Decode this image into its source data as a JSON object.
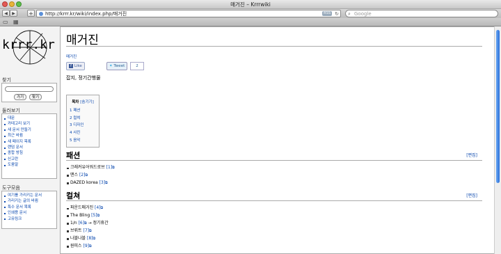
{
  "window": {
    "title": "매거진 – Krrrwiki"
  },
  "browser": {
    "back_label": "◀",
    "forward_label": "▶",
    "add_label": "+",
    "url": "http://krrr.kr/wiki/index.php/매거진",
    "rss_label": "RSS",
    "search_placeholder": "Google"
  },
  "sidebar": {
    "logo_text": "krrr.kr",
    "search_heading": "찾기",
    "go_button": "가기",
    "search_button": "찾기",
    "nav_heading": "둘러보기",
    "nav_items": [
      "대문",
      "카테고리 보기",
      "새 문서 만들기",
      "최근 바뀜",
      "새 페이지 목록",
      "랜덤 문서",
      "종합 방침",
      "신고란",
      "도움말"
    ],
    "tools_heading": "도구모음",
    "tool_items": [
      "여기를 가리키는 문서",
      "가리키는 글의 바뀜",
      "특수 문서 목록",
      "인쇄용 문서",
      "고유링크"
    ]
  },
  "content": {
    "title": "매거진",
    "category_tag": "매거진",
    "like_label": "Like",
    "tweet_label": "Tweet",
    "tweet_count": "2",
    "description": "잡지, 정기간행물",
    "toc": {
      "title": "목차",
      "toggle": "[숨기기]",
      "items": [
        "1 패션",
        "2 컬쳐",
        "3 디자인",
        "4 사진",
        "5 음악"
      ]
    },
    "sections": [
      {
        "heading": "패션",
        "edit": "[편집]",
        "items": [
          {
            "text": "크래커유어워드로브",
            "ref": "[1]",
            "extra": ""
          },
          {
            "text": "맨스",
            "ref": "[2]",
            "extra": ""
          },
          {
            "text": "DAZED korea",
            "ref": "[3]",
            "extra": ""
          }
        ]
      },
      {
        "heading": "컬쳐",
        "edit": "[편집]",
        "items": [
          {
            "text": "파운드매거진",
            "ref": "[4]",
            "extra": ""
          },
          {
            "text": "The Bling",
            "ref": "[5]",
            "extra": ""
          },
          {
            "text": "1/n",
            "ref": "[6]",
            "extra": "→ 정기휴간"
          },
          {
            "text": "브뤼트",
            "ref": "[7]",
            "extra": ""
          },
          {
            "text": "나블나블",
            "ref": "[8]",
            "extra": ""
          },
          {
            "text": "원피스",
            "ref": "[9]",
            "extra": ""
          }
        ]
      }
    ]
  }
}
